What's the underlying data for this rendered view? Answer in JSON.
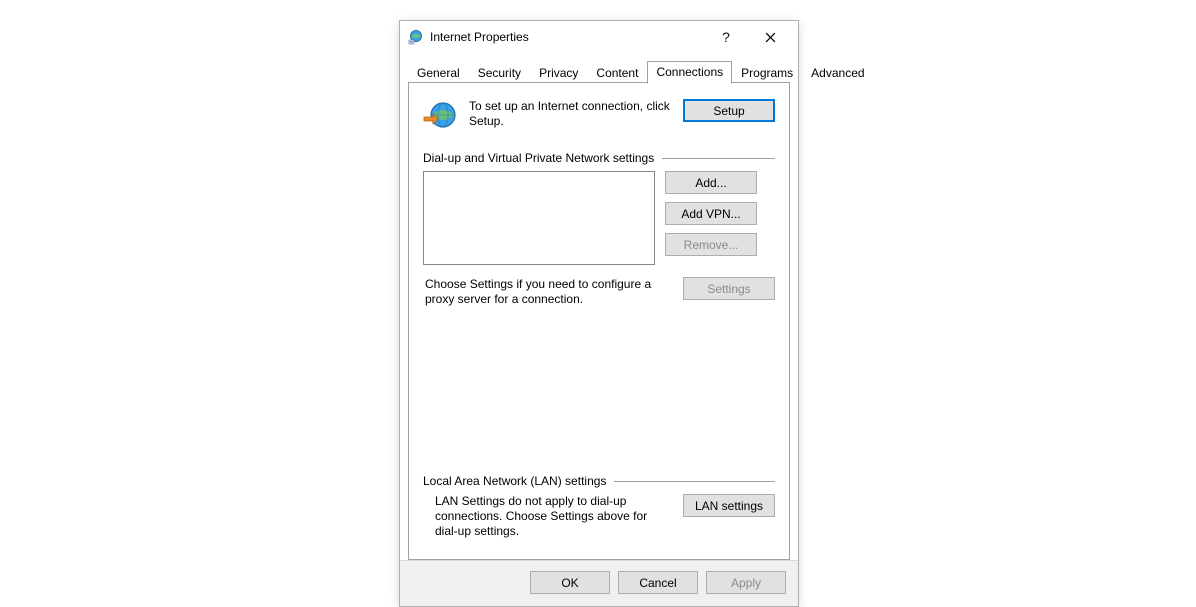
{
  "title": "Internet Properties",
  "tabs": {
    "general": "General",
    "security": "Security",
    "privacy": "Privacy",
    "content": "Content",
    "connections": "Connections",
    "programs": "Programs",
    "advanced": "Advanced"
  },
  "top_text": "To set up an Internet connection, click Setup.",
  "setup_label": "Setup",
  "dialup_group": "Dial-up and Virtual Private Network settings",
  "add_label": "Add...",
  "addvpn_label": "Add VPN...",
  "remove_label": "Remove...",
  "settings_label": "Settings",
  "choose_text": "Choose Settings if you need to configure a proxy server for a connection.",
  "lan_group": "Local Area Network (LAN) settings",
  "lan_text": "LAN Settings do not apply to dial-up connections. Choose Settings above for dial-up settings.",
  "lan_btn": "LAN settings",
  "ok": "OK",
  "cancel": "Cancel",
  "apply": "Apply"
}
